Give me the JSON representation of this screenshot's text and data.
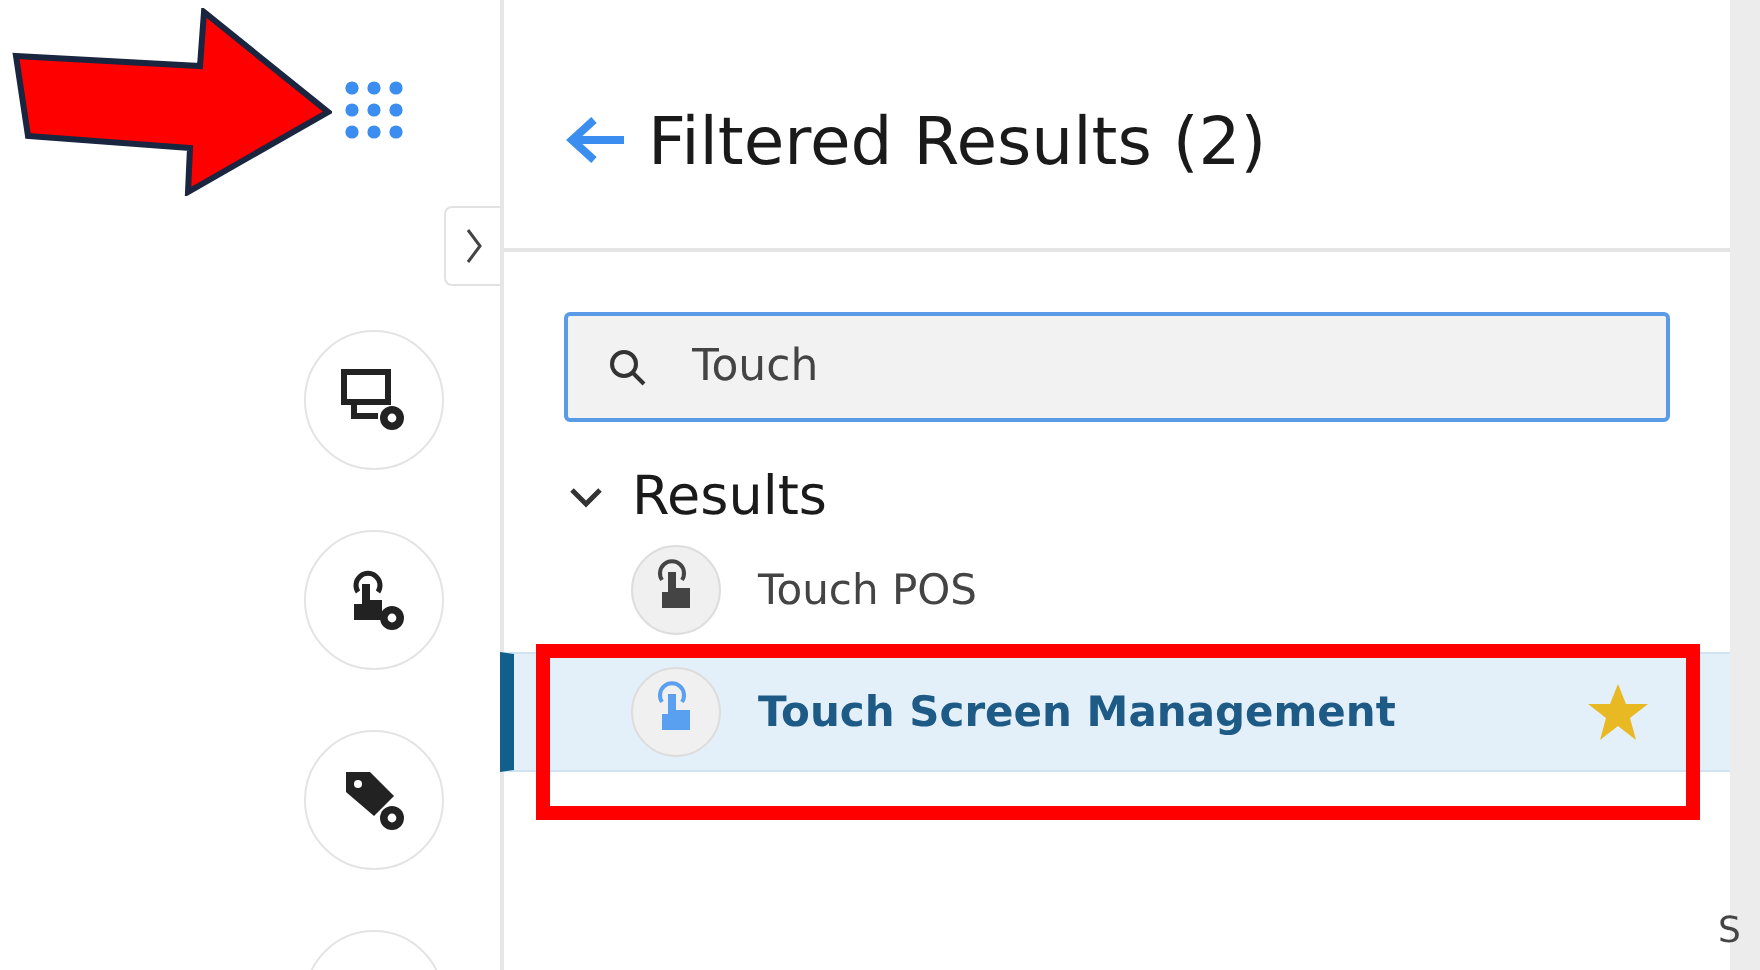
{
  "panel": {
    "title": "Filtered Results (2)"
  },
  "search": {
    "value": "Touch"
  },
  "results": {
    "heading": "Results",
    "expanded": true,
    "items": [
      {
        "label": "Touch POS",
        "selected": false,
        "starred": false
      },
      {
        "label": "Touch Screen Management",
        "selected": true,
        "starred": true
      }
    ]
  },
  "edge_text": "S"
}
